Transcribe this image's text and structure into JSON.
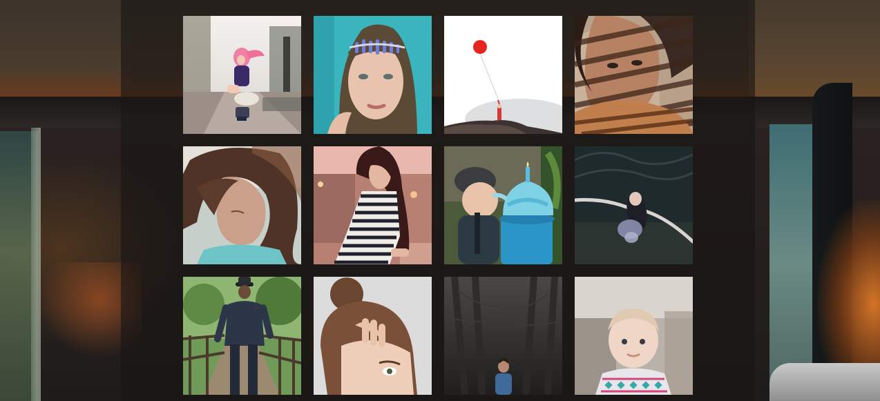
{
  "gallery": {
    "photos": [
      {
        "subject": "girl-pink-hair-crouching"
      },
      {
        "subject": "woman-crystal-headband"
      },
      {
        "subject": "red-balloon-hilltop"
      },
      {
        "subject": "woman-striped-shadows"
      },
      {
        "subject": "girl-windblown-hair"
      },
      {
        "subject": "woman-striped-dress"
      },
      {
        "subject": "boy-blue-cupcake"
      },
      {
        "subject": "woman-floating-water"
      },
      {
        "subject": "man-on-bridge"
      },
      {
        "subject": "woman-hair-bun"
      },
      {
        "subject": "person-in-forest"
      },
      {
        "subject": "baby-knit-sweater"
      }
    ]
  }
}
